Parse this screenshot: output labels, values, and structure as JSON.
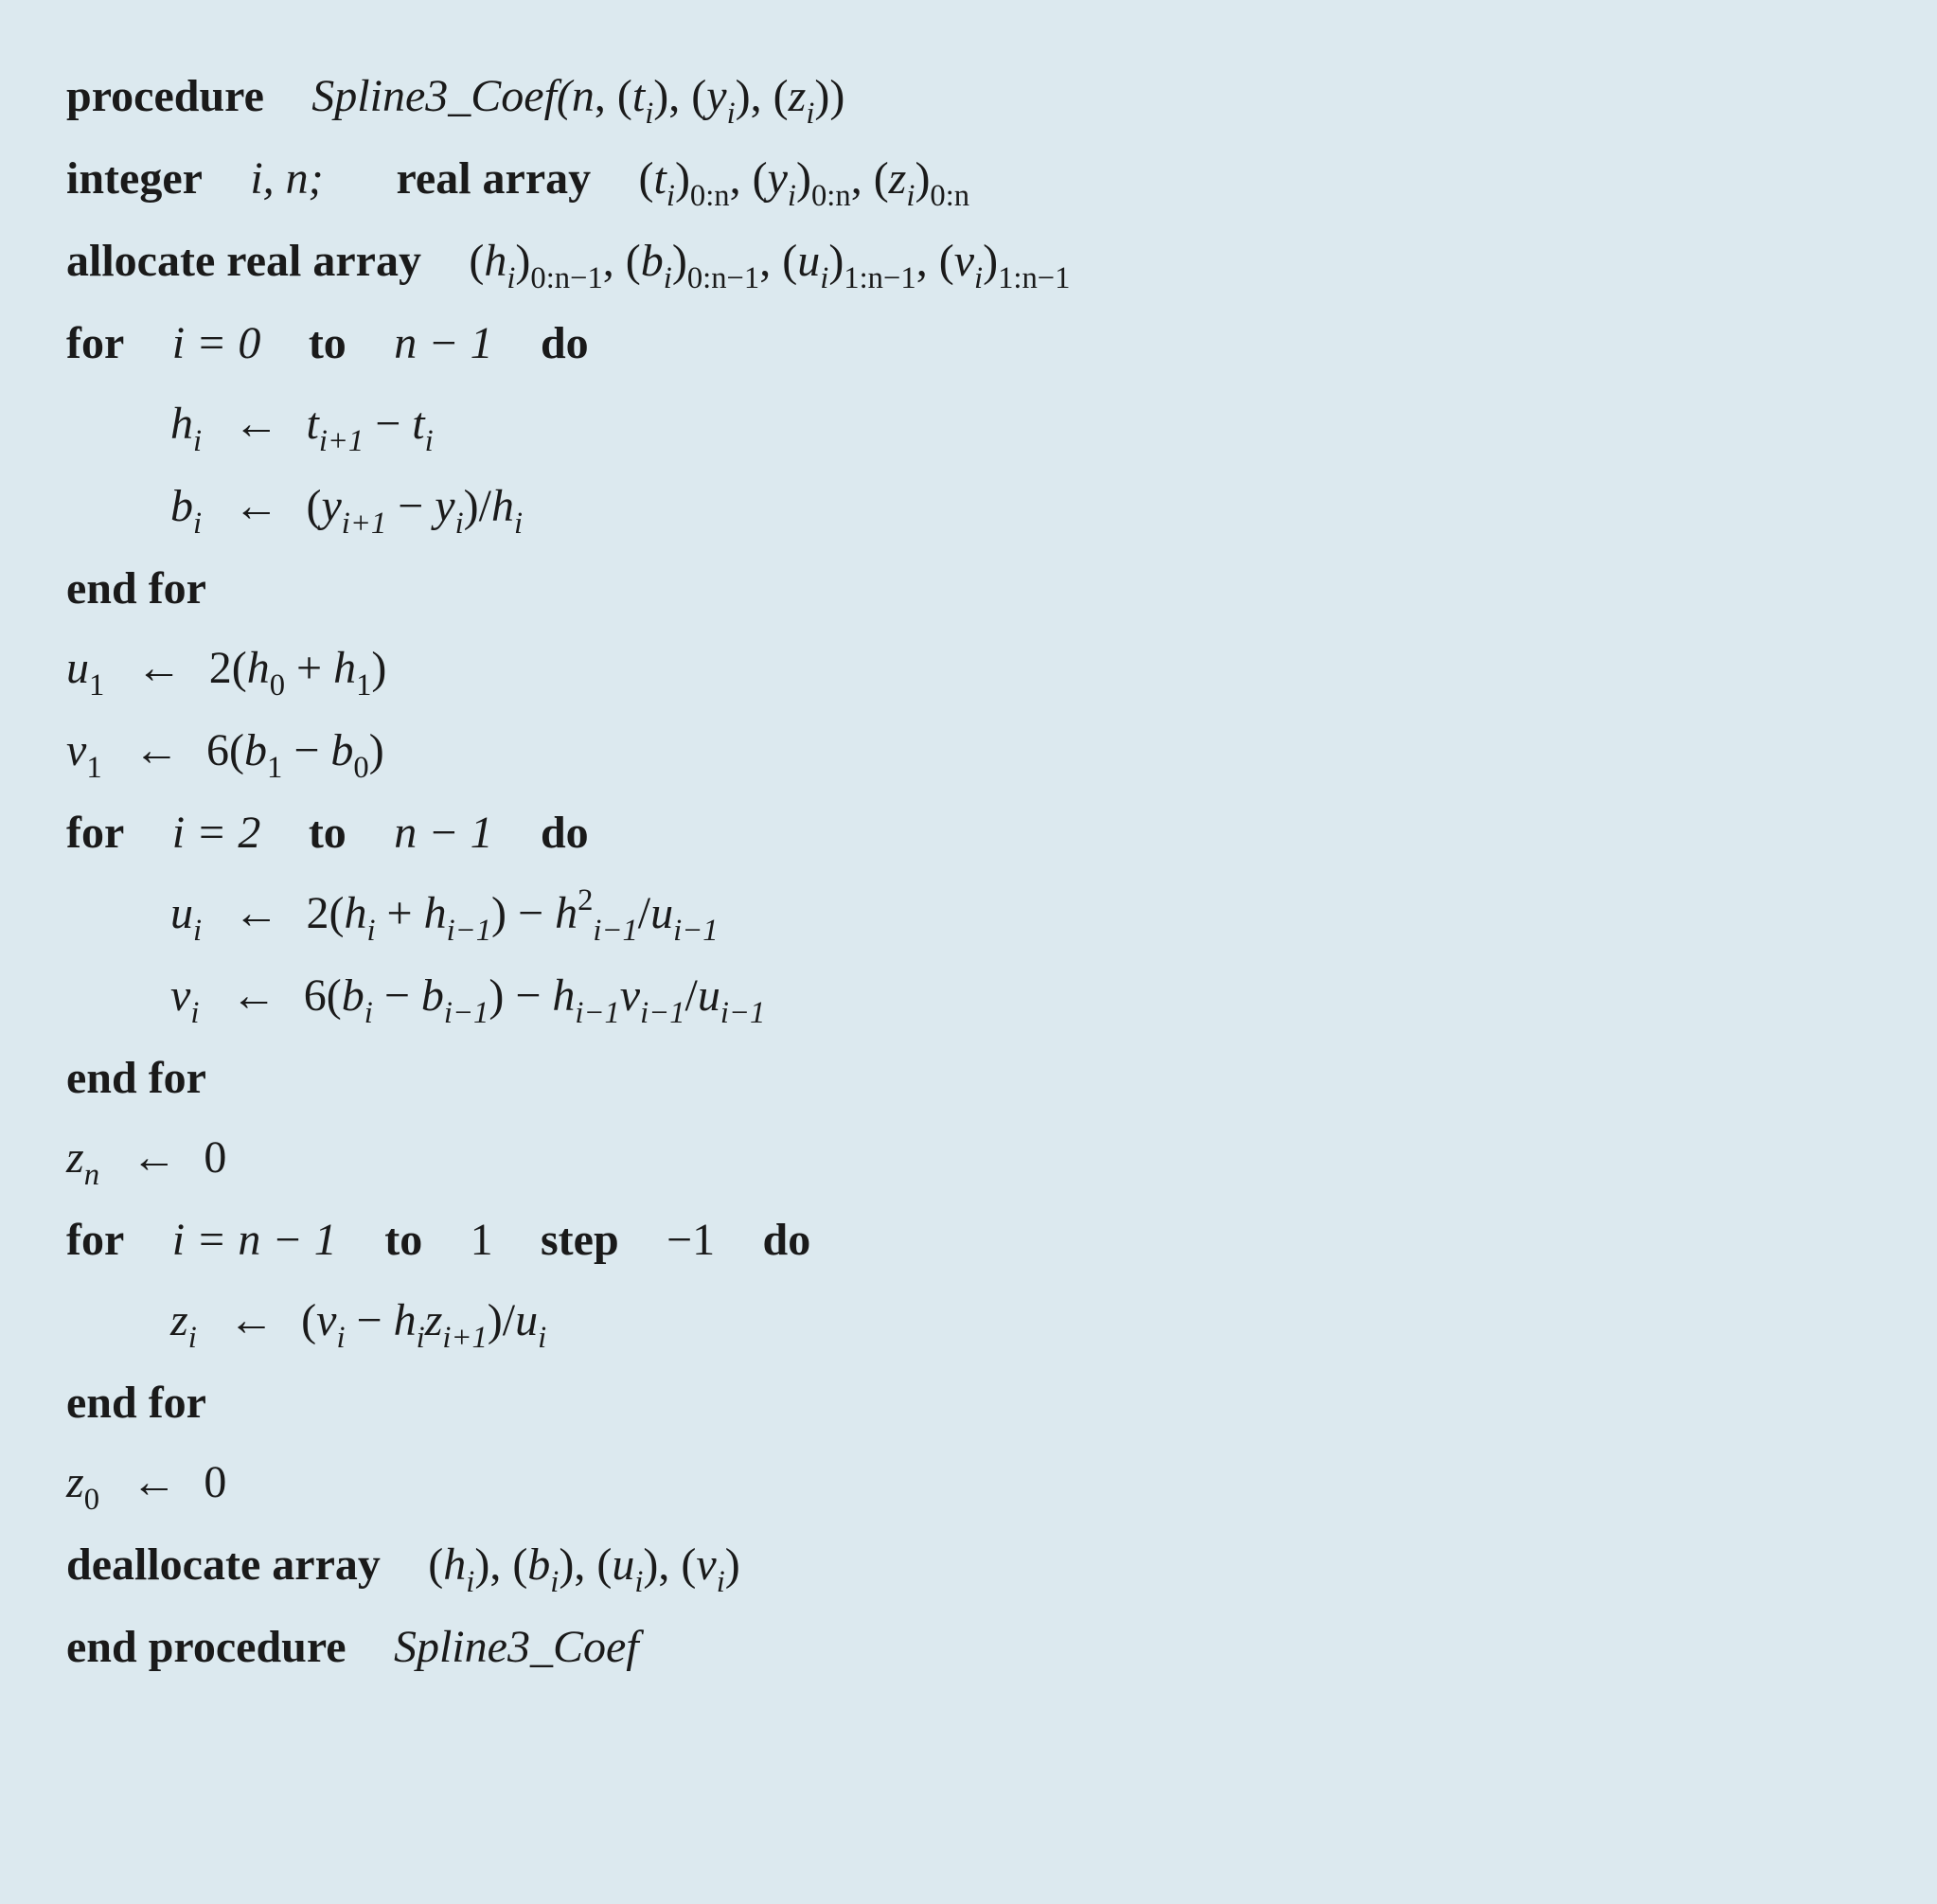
{
  "proc": {
    "kw_procedure": "procedure",
    "name": "Spline3_Coef",
    "args_open": "(",
    "args_close": ")",
    "arg_n": "n",
    "arg_t": "t",
    "arg_y": "y",
    "arg_z": "z",
    "i": "i"
  },
  "decl": {
    "kw_integer": "integer",
    "kw_real_array": "real array",
    "kw_allocate": "allocate real array",
    "kw_dealloc": "deallocate array",
    "vars_int": "i, n;",
    "range_0n": "0:n",
    "range_0n1": "0:n−1",
    "range_1n1": "1:n−1",
    "h": "h",
    "b": "b",
    "u": "u",
    "v": "v"
  },
  "loop": {
    "kw_for": "for",
    "kw_do": "do",
    "kw_end_for": "end for",
    "kw_to": "to",
    "kw_step": "step",
    "i_eq_0": "i = 0",
    "i_eq_2": "i = 2",
    "i_eq_nm1": "i = n − 1",
    "nm1": "n − 1",
    "one": "1",
    "neg1": "−1"
  },
  "sym": {
    "assign": "←",
    "minus": "−",
    "plus": "+",
    "slash": "/",
    "two": "2",
    "six": "6",
    "zero": "0",
    "ip1": "i+1",
    "im1": "i−1",
    "n": "n",
    "i": "i",
    "sq": "2"
  },
  "end": {
    "kw_end_procedure": "end procedure"
  }
}
